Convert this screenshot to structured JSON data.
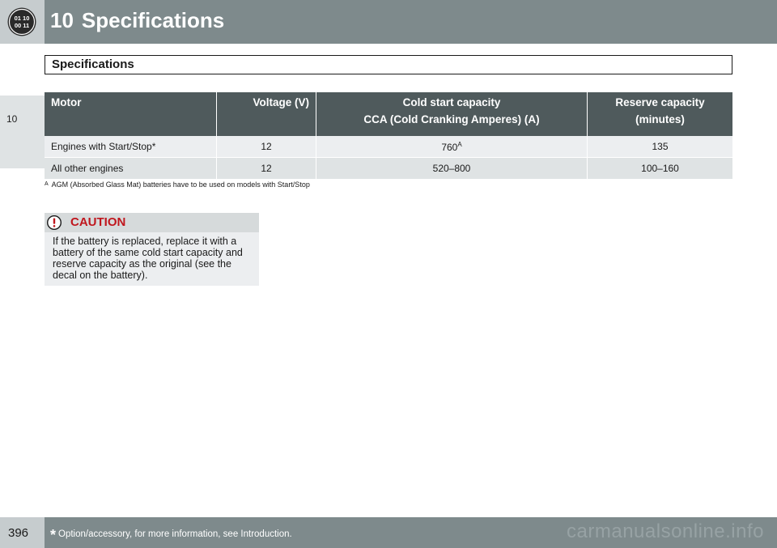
{
  "header": {
    "chapter_number": "10",
    "chapter_title": "Specifications",
    "logo_icon": "dashboard-gauge-icon"
  },
  "side_tab": {
    "label": "10"
  },
  "section": {
    "title": "Specifications"
  },
  "table": {
    "headers": {
      "motor": "Motor",
      "voltage": "Voltage (V)",
      "cca_line1": "Cold start capacity",
      "cca_line2": "CCA (Cold Cranking Amperes) (A)",
      "reserve_line1": "Reserve capacity",
      "reserve_line2": "(minutes)"
    },
    "rows": [
      {
        "motor": "Engines with Start/Stop*",
        "voltage": "12",
        "cca": "760",
        "cca_sup": "A",
        "reserve": "135"
      },
      {
        "motor": "All other engines",
        "voltage": "12",
        "cca": "520–800",
        "cca_sup": "",
        "reserve": "100–160"
      }
    ]
  },
  "footnote": {
    "marker": "A",
    "text": "AGM (Absorbed Glass Mat) batteries have to be used on models with Start/Stop"
  },
  "caution": {
    "title": "CAUTION",
    "icon": "exclamation-circle-icon",
    "text": "If the battery is replaced, replace it with a battery of the same cold start capacity and reserve capacity as the original (see the decal on the battery)."
  },
  "footer": {
    "page_number": "396",
    "star": "*",
    "note": "Option/accessory, for more information, see Introduction.",
    "watermark": "carmanualsonline.info"
  },
  "colors": {
    "header_bg": "#7e8a8c",
    "table_header_bg": "#4f5a5c",
    "caution_red": "#c0161d"
  }
}
